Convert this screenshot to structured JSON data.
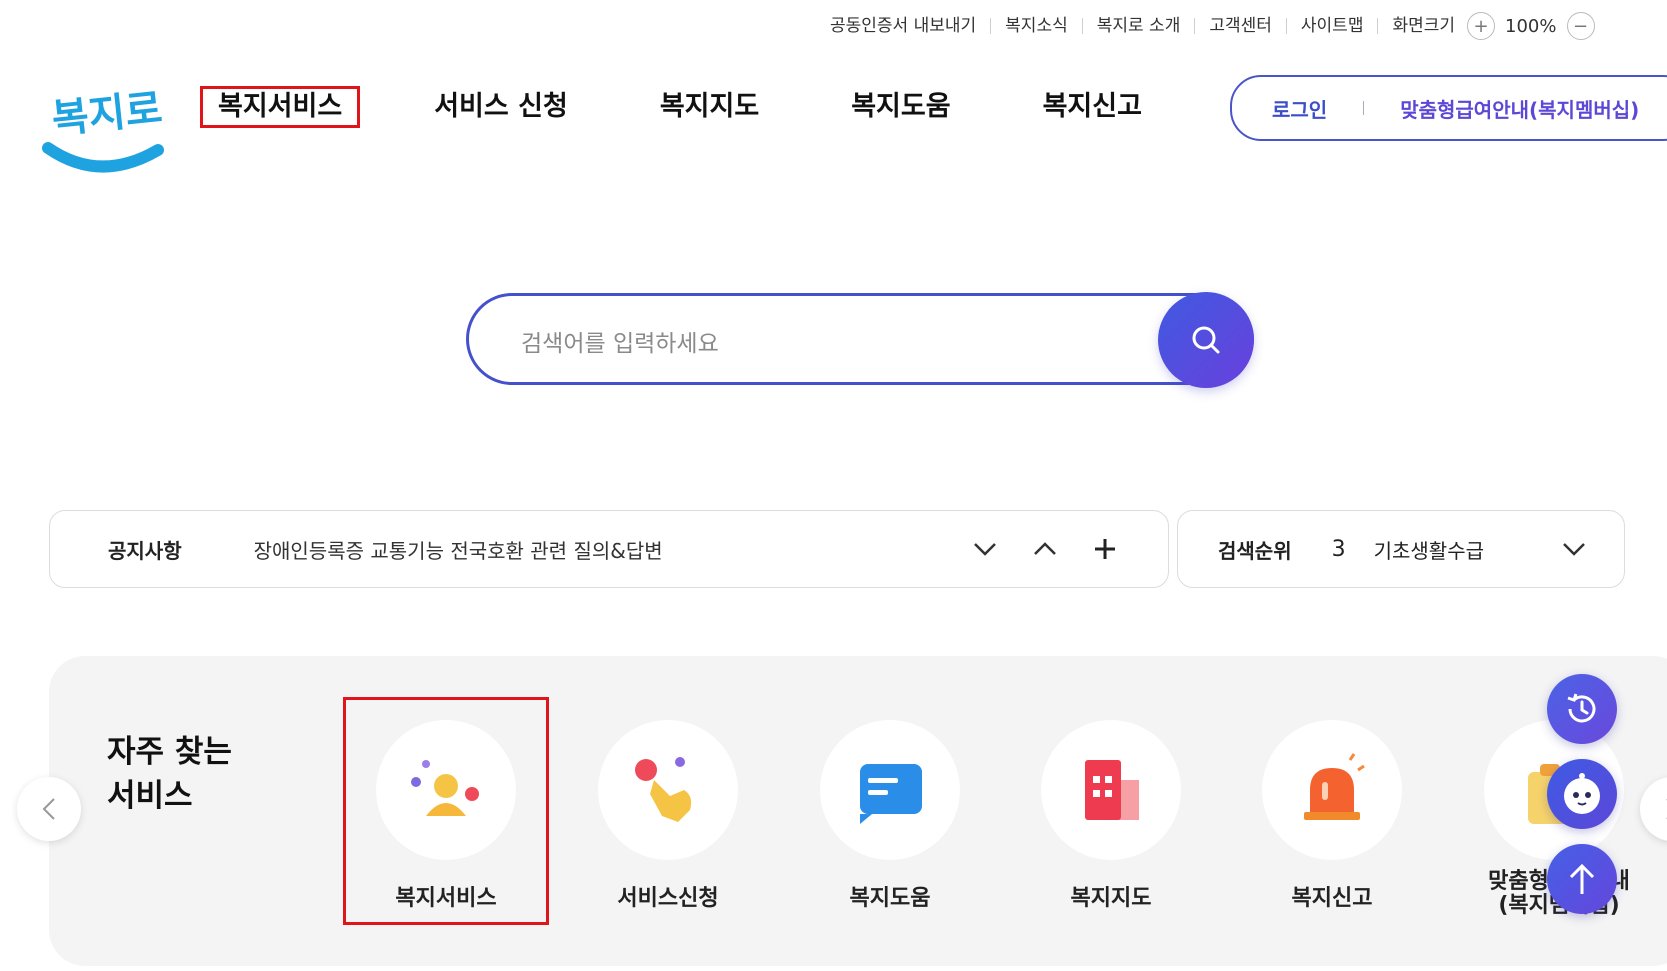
{
  "utility": {
    "items": [
      "공동인증서 내보내기",
      "복지소식",
      "복지로 소개",
      "고객센터",
      "사이트맵"
    ],
    "zoom_label": "화면크기",
    "zoom_in": "+",
    "zoom_value": "100%",
    "zoom_out": "−"
  },
  "logo": {
    "text": "복지로",
    "brand_color": "#1fa3e0"
  },
  "nav": {
    "items": [
      "복지서비스",
      "서비스 신청",
      "복지지도",
      "복지도움",
      "복지신고"
    ],
    "active_index": 0
  },
  "account": {
    "login": "로그인",
    "membership": "맞춤형급여안내(복지멤버십)"
  },
  "search": {
    "placeholder": "검색어를 입력하세요"
  },
  "notice": {
    "title": "공지사항",
    "text": "장애인등록증 교통기능 전국호환 관련 질의&답변"
  },
  "rank": {
    "title": "검색순위",
    "number": "3",
    "text": "기초생활수급"
  },
  "frequent": {
    "title_line1": "자주 찾는",
    "title_line2": "서비스",
    "items": [
      {
        "label": "복지서비스",
        "icon": "person-icon"
      },
      {
        "label": "서비스신청",
        "icon": "hand-tap-icon"
      },
      {
        "label": "복지도움",
        "icon": "chat-card-icon"
      },
      {
        "label": "복지지도",
        "icon": "building-icon"
      },
      {
        "label": "복지신고",
        "icon": "alarm-siren-icon"
      },
      {
        "label": "맞춤형급여안내(복지멤버십)",
        "icon": "clipboard-icon"
      }
    ]
  },
  "colors": {
    "accent": "#4550cc",
    "highlight": "#e0141b",
    "purple": "#5b48d6"
  }
}
